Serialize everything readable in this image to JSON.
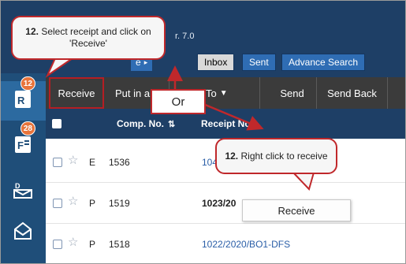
{
  "app": {
    "version_fragment": "r. 7.0"
  },
  "sidebar": {
    "items": [
      {
        "icon": "receipt-icon",
        "badge": "12"
      },
      {
        "icon": "file-icon",
        "badge": "28"
      },
      {
        "icon": "dispatch-mail-icon",
        "badge": ""
      },
      {
        "icon": "dak-icon",
        "badge": ""
      }
    ]
  },
  "nav": {
    "fragment": "e",
    "tabs": [
      "Inbox",
      "Sent",
      "Advance Search"
    ]
  },
  "toolbar": {
    "receive": "Receive",
    "put_in": "Put in a",
    "to": "To",
    "send": "Send",
    "send_back": "Send Back"
  },
  "table": {
    "headers": {
      "comp_no": "Comp. No.",
      "receipt_no": "Receipt No."
    },
    "rows": [
      {
        "type": "E",
        "comp_no": "1536",
        "receipt_no": "104"
      },
      {
        "type": "P",
        "comp_no": "1519",
        "receipt_no": "1023/20"
      },
      {
        "type": "P",
        "comp_no": "1518",
        "receipt_no": "1022/2020/BO1-DFS"
      }
    ]
  },
  "context_menu": {
    "item": "Receive"
  },
  "annotations": {
    "callout1": {
      "num": "12.",
      "text": "Select receipt and click on 'Receive'"
    },
    "callout2": {
      "num": "12.",
      "text": "Right click  to receive"
    },
    "or_label": "Or"
  },
  "colors": {
    "accent": "#c0282b",
    "header": "#1e3f66",
    "toolbar": "#3b3b3b",
    "badge": "#e8743b",
    "link": "#2a5ea7"
  }
}
